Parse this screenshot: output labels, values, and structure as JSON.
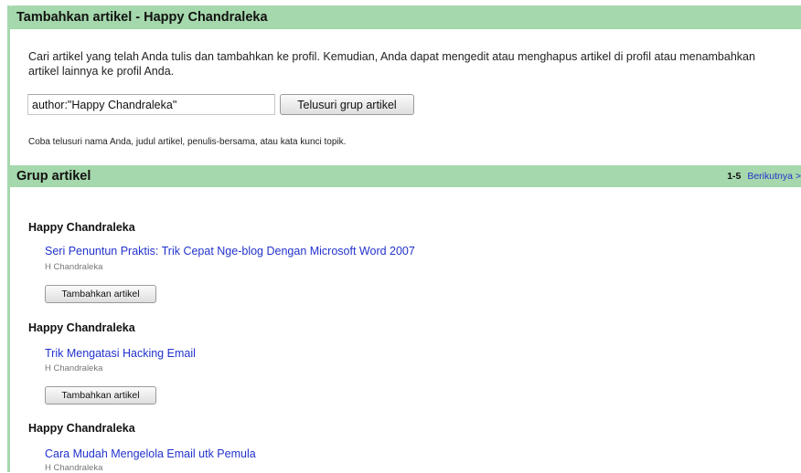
{
  "header": {
    "title": "Tambahkan artikel - Happy Chandraleka"
  },
  "intro": {
    "text": "Cari artikel yang telah Anda tulis dan tambahkan ke profil. Kemudian, Anda dapat mengedit atau menghapus artikel di profil atau menambahkan artikel lainnya ke profil Anda."
  },
  "search": {
    "value": "author:\"Happy Chandraleka\"",
    "button_label": "Telusuri grup artikel",
    "hint": "Coba telusuri nama Anda, judul artikel, penulis-bersama, atau kata kunci topik."
  },
  "groups": {
    "title": "Grup artikel",
    "range": "1-5",
    "next_label": "Berikutnya >"
  },
  "items": [
    {
      "author": "Happy Chandraleka",
      "title": "Seri Penuntun Praktis: Trik Cepat Nge-blog Dengan Microsoft Word 2007",
      "byline": "H Chandraleka",
      "add_label": "Tambahkan artikel"
    },
    {
      "author": "Happy Chandraleka",
      "title": "Trik Mengatasi Hacking Email",
      "byline": "H Chandraleka",
      "add_label": "Tambahkan artikel"
    },
    {
      "author": "Happy Chandraleka",
      "title": "Cara Mudah Mengelola Email utk Pemula",
      "byline": "H Chandraleka"
    }
  ],
  "colors": {
    "accent_bar": "#a5d8ac",
    "link": "#2233cc"
  }
}
